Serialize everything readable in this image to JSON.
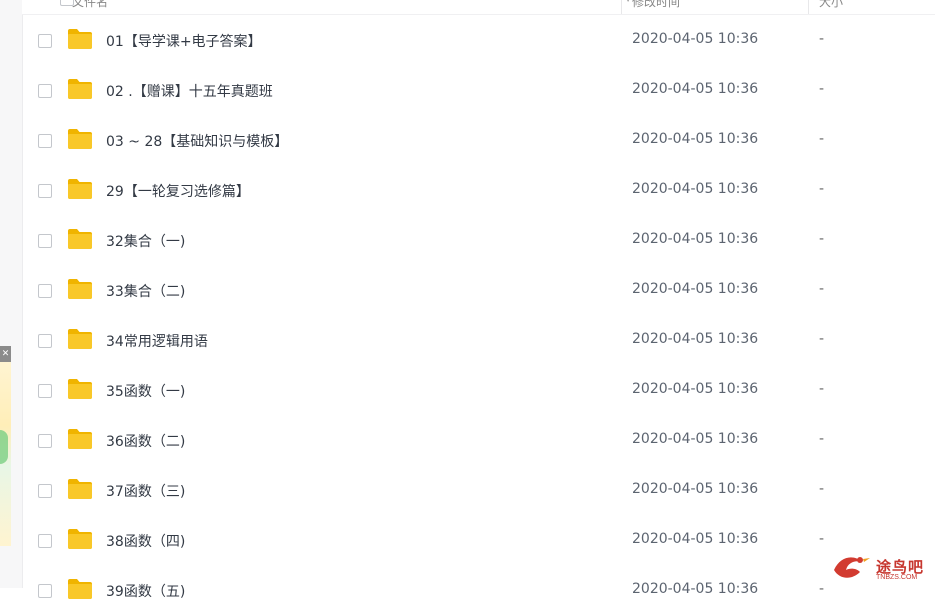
{
  "header": {
    "col_name": "文件名",
    "col_modified": "修改时间",
    "col_size": "大小"
  },
  "files": [
    {
      "name": "01【导学课+电子答案】",
      "modified": "2020-04-05 10:36",
      "size": "-"
    },
    {
      "name": "02 .【赠课】十五年真题班",
      "modified": "2020-04-05 10:36",
      "size": "-"
    },
    {
      "name": "03 ~ 28【基础知识与模板】",
      "modified": "2020-04-05 10:36",
      "size": "-"
    },
    {
      "name": "29【一轮复习选修篇】",
      "modified": "2020-04-05 10:36",
      "size": "-"
    },
    {
      "name": "32集合（一)",
      "modified": "2020-04-05 10:36",
      "size": "-"
    },
    {
      "name": "33集合（二)",
      "modified": "2020-04-05 10:36",
      "size": "-"
    },
    {
      "name": "34常用逻辑用语",
      "modified": "2020-04-05 10:36",
      "size": "-"
    },
    {
      "name": "35函数（一)",
      "modified": "2020-04-05 10:36",
      "size": "-"
    },
    {
      "name": "36函数（二)",
      "modified": "2020-04-05 10:36",
      "size": "-"
    },
    {
      "name": "37函数（三)",
      "modified": "2020-04-05 10:36",
      "size": "-"
    },
    {
      "name": "38函数（四)",
      "modified": "2020-04-05 10:36",
      "size": "-"
    },
    {
      "name": "39函数（五)",
      "modified": "2020-04-05 10:36",
      "size": "-"
    }
  ],
  "folder_icon": "folder-icon",
  "colors": {
    "folder": "#f9c829",
    "folder_tab": "#f0b400"
  },
  "watermark": {
    "text": "途鸟吧",
    "sub": "TNBZS.COM"
  }
}
